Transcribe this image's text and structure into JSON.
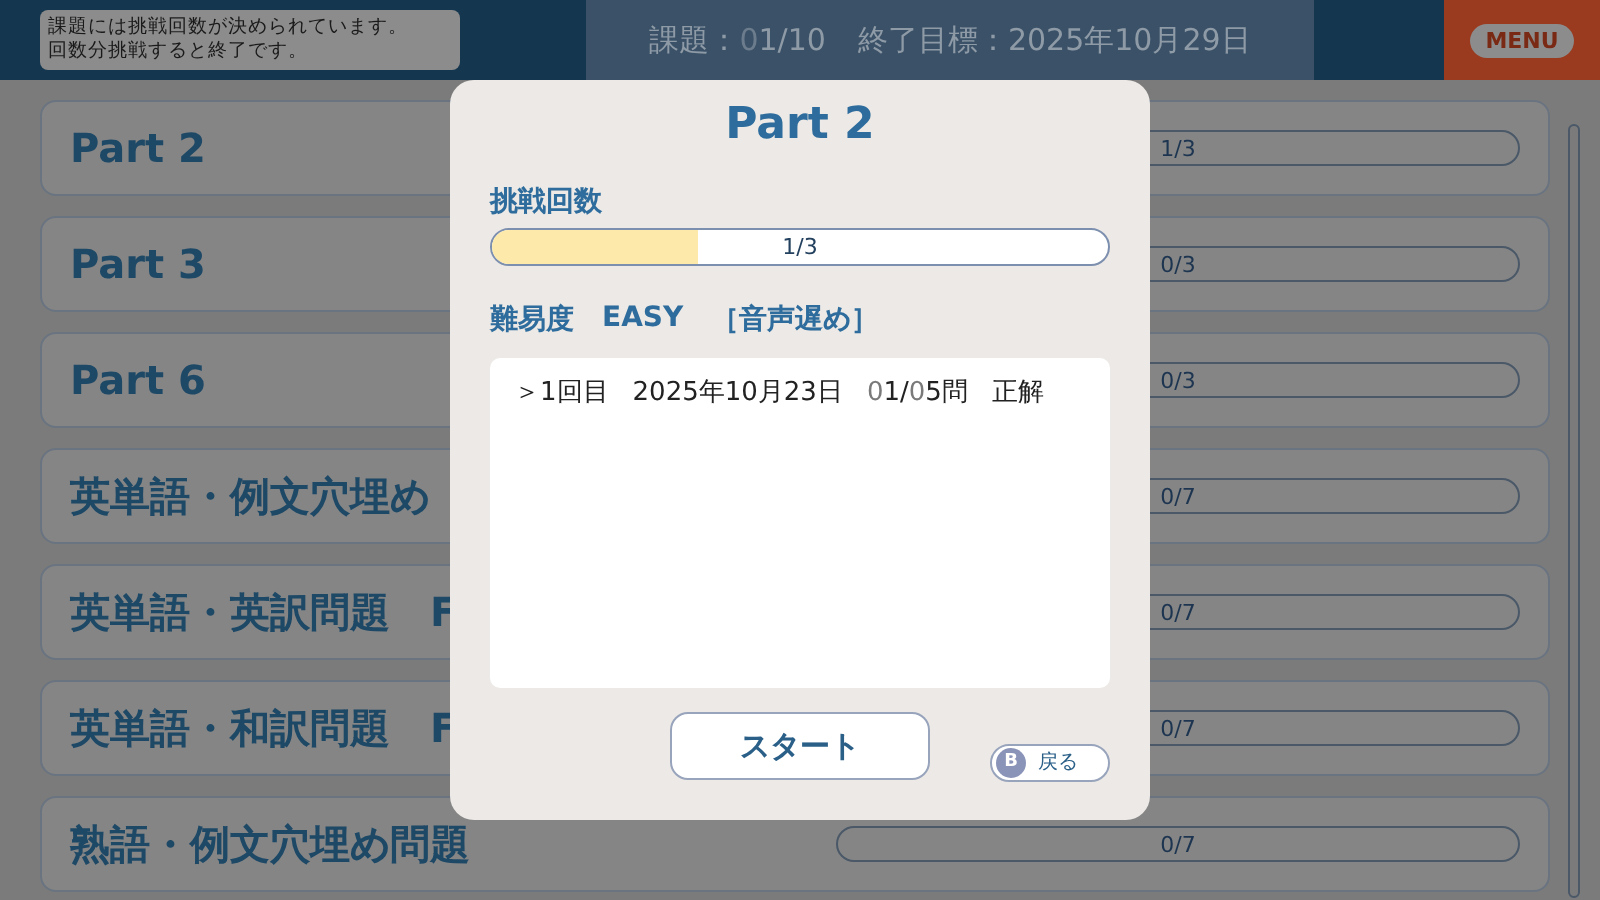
{
  "header": {
    "hint": [
      "課題には挑戦回数が決められています。",
      "回数分挑戦すると終了です。"
    ],
    "task_label": "課題：",
    "task_value": "01/10",
    "goal_label": "終了目標：",
    "goal_value": "2025年10月29日",
    "menu": "MENU"
  },
  "rows": [
    {
      "title": "Part 2",
      "reading": "1/3"
    },
    {
      "title": "Part 3",
      "reading": "0/3"
    },
    {
      "title": "Part 6",
      "reading": "0/3"
    },
    {
      "title": "英単語・例文穴埋め",
      "reading": "0/7"
    },
    {
      "title": "英単語・英訳問題　F",
      "reading": "0/7"
    },
    {
      "title": "英単語・和訳問題　F",
      "reading": "0/7"
    },
    {
      "title": "熟語・例文穴埋め問題",
      "reading": "0/7"
    }
  ],
  "dialog": {
    "title": "Part 2",
    "attempts_label": "挑戦回数",
    "attempts": {
      "level": 0.333,
      "reading": "1/3"
    },
    "difficulty": [
      "難易度",
      "EASY",
      "［音声遅め］"
    ],
    "history": [
      {
        "attempt": "＞1回目",
        "date": "2025年10月23日",
        "score": "01/05問",
        "result": "正解"
      }
    ],
    "start": "スタート",
    "back_key": "B",
    "back": "戻る"
  }
}
